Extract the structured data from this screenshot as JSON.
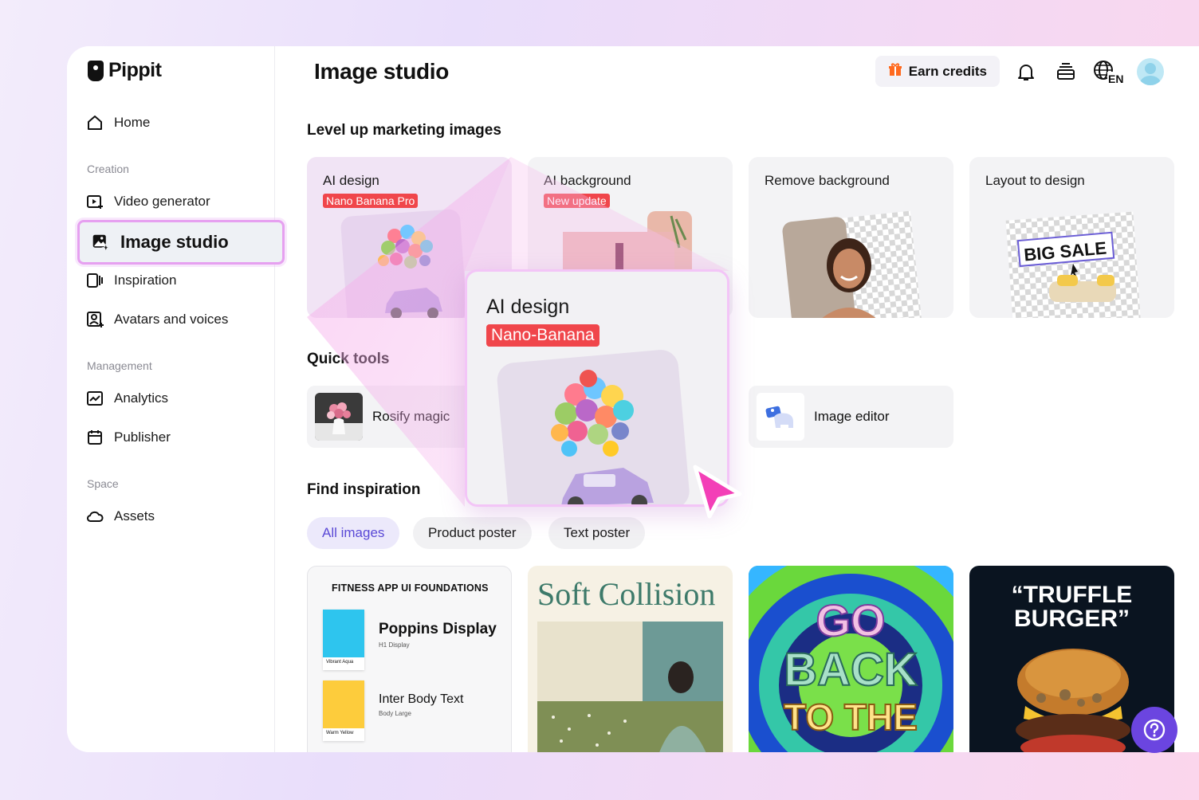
{
  "app": {
    "logo_text": "Pippit"
  },
  "sidebar": {
    "home": "Home",
    "sections": {
      "creation": "Creation",
      "management": "Management",
      "space": "Space"
    },
    "items": {
      "video_generator": "Video generator",
      "image_studio": "Image studio",
      "inspiration": "Inspiration",
      "avatars": "Avatars and voices",
      "analytics": "Analytics",
      "publisher": "Publisher",
      "assets": "Assets"
    }
  },
  "header": {
    "title": "Image studio",
    "earn_credits": "Earn credits",
    "language": "EN"
  },
  "marketing": {
    "title": "Level up marketing images",
    "cards": [
      {
        "title": "AI design",
        "badge": "Nano Banana Pro"
      },
      {
        "title": "AI background",
        "badge": "New update"
      },
      {
        "title": "Remove background"
      },
      {
        "title": "Layout to design",
        "overlay_text": "BIG SALE"
      }
    ]
  },
  "quick_tools": {
    "title": "Quick tools",
    "items": [
      {
        "label": "Rosify magic"
      },
      {
        "label": "Image editor"
      }
    ]
  },
  "popup": {
    "title": "AI design",
    "badge": "Nano-Banana"
  },
  "inspiration": {
    "title": "Find inspiration",
    "chips": [
      "All images",
      "Product poster",
      "Text poster"
    ],
    "cards": {
      "fitness": {
        "heading": "FITNESS APP UI FOUNDATIONS",
        "font1": "Poppins Display",
        "font1_sub": "H1 Display",
        "swatch1": "Vibrant Aqua",
        "font2": "Inter Body Text",
        "font2_sub": "Body Large",
        "swatch2": "Warm Yellow"
      },
      "soft": {
        "title": "Soft Collision"
      },
      "retro": {
        "line1": "GO",
        "line2": "BACK",
        "line3": "TO THE"
      },
      "burger": {
        "title": "“TRUFFLE BURGER”"
      }
    }
  },
  "colors": {
    "accent": "#6b45e0",
    "badge": "#f0464b",
    "active_border": "#e6a0f0"
  }
}
